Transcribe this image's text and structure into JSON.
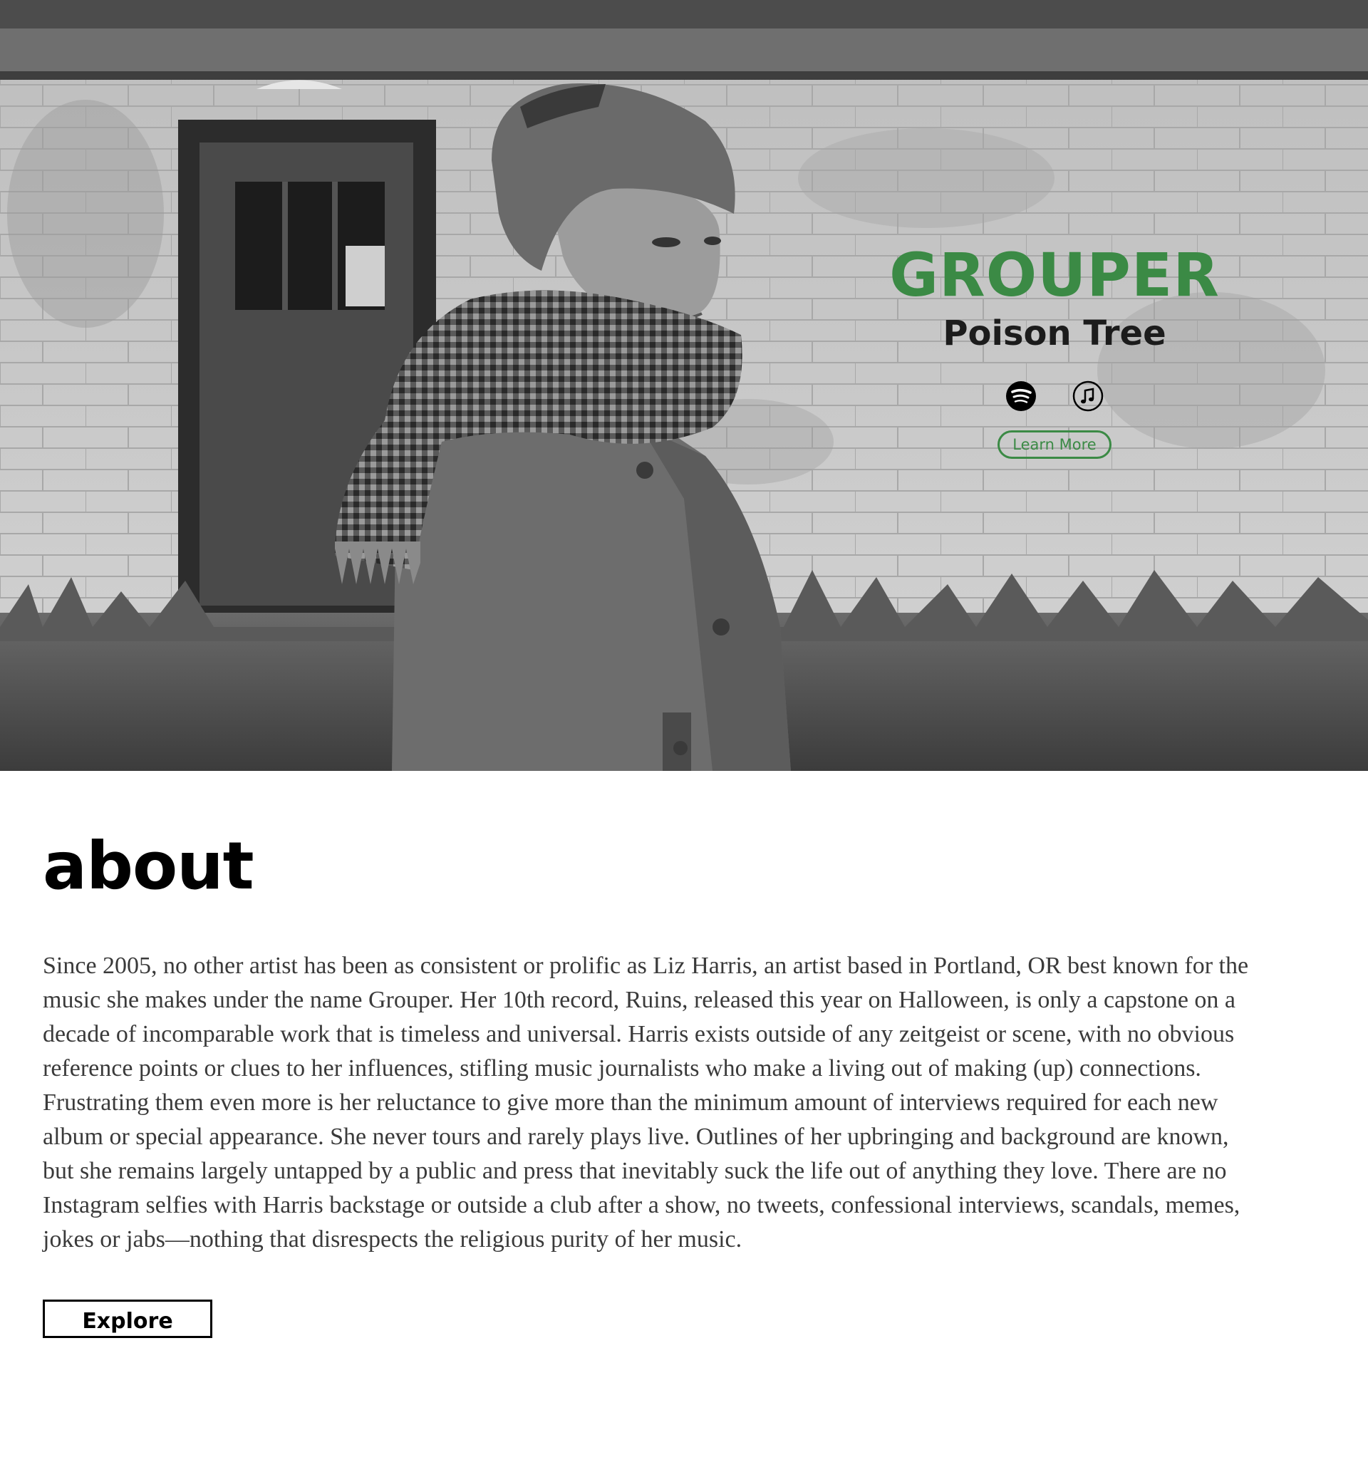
{
  "hero": {
    "band_name": "GROUPER",
    "album_title": "Poison Tree",
    "stream_links": [
      {
        "icon": "spotify-icon"
      },
      {
        "icon": "apple-music-icon"
      }
    ],
    "learn_more_label": "Learn More",
    "accent_color": "#3b8a45"
  },
  "about": {
    "title": "about",
    "body": "Since 2005, no other artist has been as consistent or prolific as Liz Harris, an artist based in Portland, OR best known for the music she makes under the name Grouper. Her 10th record, Ruins, released this year on Halloween, is only a capstone on a decade of incomparable work that is timeless and universal. Harris exists outside of any zeitgeist or scene, with no obvious reference points or clues to her influences, stifling music journalists who make a living out of making (up) connections. Frustrating them even more is her reluctance to give more than the minimum amount of interviews required for each new album or special appearance. She never tours and rarely plays live. Outlines of her upbringing and background are known, but she remains largely untapped by a public and press that inevitably suck the life out of anything they love. There are no Instagram selfies with Harris backstage or outside a club after a show, no tweets, confessional interviews, scandals, memes, jokes or jabs—nothing that disrespects the religious purity of her music.",
    "explore_label": "Explore"
  }
}
